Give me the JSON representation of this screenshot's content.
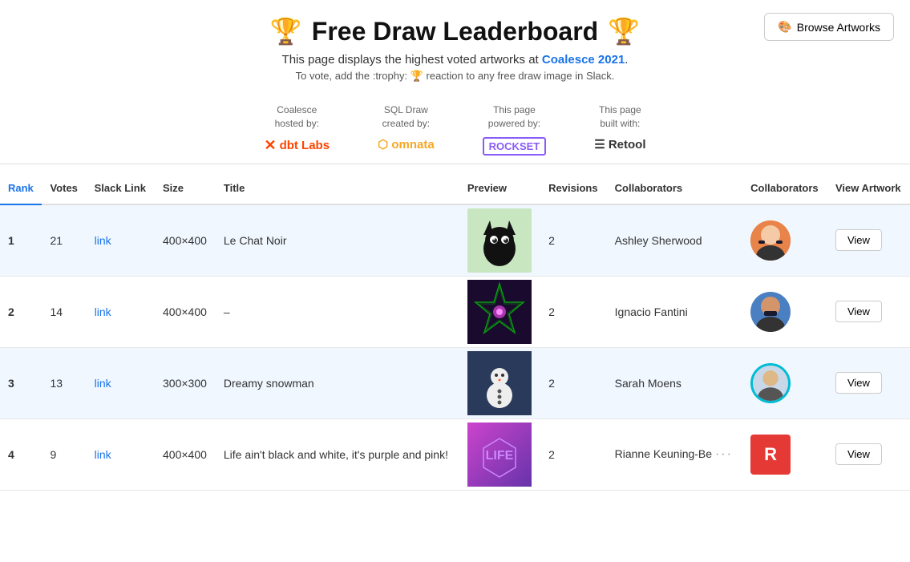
{
  "header": {
    "title": "Free Draw Leaderboard",
    "trophy_icon": "🏆",
    "subtitle_text": "This page displays the highest voted artworks at",
    "subtitle_link_text": "Coalesce 2021",
    "subtitle_link_url": "#",
    "vote_instruction": "To vote, add the :trophy: 🏆 reaction to any free draw image in Slack.",
    "browse_button_label": "Browse Artworks",
    "browse_icon": "🎨"
  },
  "sponsors": [
    {
      "id": "coalesce",
      "label": "Coalesce\nhosted by:",
      "logo": "✕ dbt Labs",
      "type": "dbt"
    },
    {
      "id": "sqldraw",
      "label": "SQL Draw\ncreated by:",
      "logo": "omnata",
      "type": "omnata"
    },
    {
      "id": "powered",
      "label": "This page\npowered by:",
      "logo": "ROCKSET",
      "type": "rockset"
    },
    {
      "id": "built",
      "label": "This page\nbuilt with:",
      "logo": "≡ Retool",
      "type": "retool"
    }
  ],
  "table": {
    "columns": [
      "Rank",
      "Votes",
      "Slack Link",
      "Size",
      "Title",
      "Preview",
      "Revisions",
      "Collaborators",
      "Collaborators",
      "View Artwork"
    ],
    "rows": [
      {
        "rank": 1,
        "votes": 21,
        "link": "link",
        "size": "400×400",
        "title": "Le Chat Noir",
        "preview_type": "cat",
        "revisions": 2,
        "collaborator_name": "Ashley Sherwood",
        "collaborator_avatar_type": "orange",
        "collaborator_initial": "",
        "view_label": "View"
      },
      {
        "rank": 2,
        "votes": 14,
        "link": "link",
        "size": "400×400",
        "title": "–",
        "preview_type": "star",
        "revisions": 2,
        "collaborator_name": "Ignacio Fantini",
        "collaborator_avatar_type": "blue",
        "collaborator_initial": "",
        "view_label": "View"
      },
      {
        "rank": 3,
        "votes": 13,
        "link": "link",
        "size": "300×300",
        "title": "Dreamy snowman",
        "preview_type": "snowman",
        "revisions": 2,
        "collaborator_name": "Sarah Moens",
        "collaborator_avatar_type": "teal",
        "collaborator_initial": "",
        "view_label": "View"
      },
      {
        "rank": 4,
        "votes": 9,
        "link": "link",
        "size": "400×400",
        "title": "Life ain't black and white, it's purple and pink!",
        "preview_type": "life",
        "revisions": 2,
        "collaborator_name": "Rianne Keuning-Be",
        "collaborator_avatar_type": "red",
        "collaborator_initial": "R",
        "view_label": "View"
      }
    ]
  }
}
